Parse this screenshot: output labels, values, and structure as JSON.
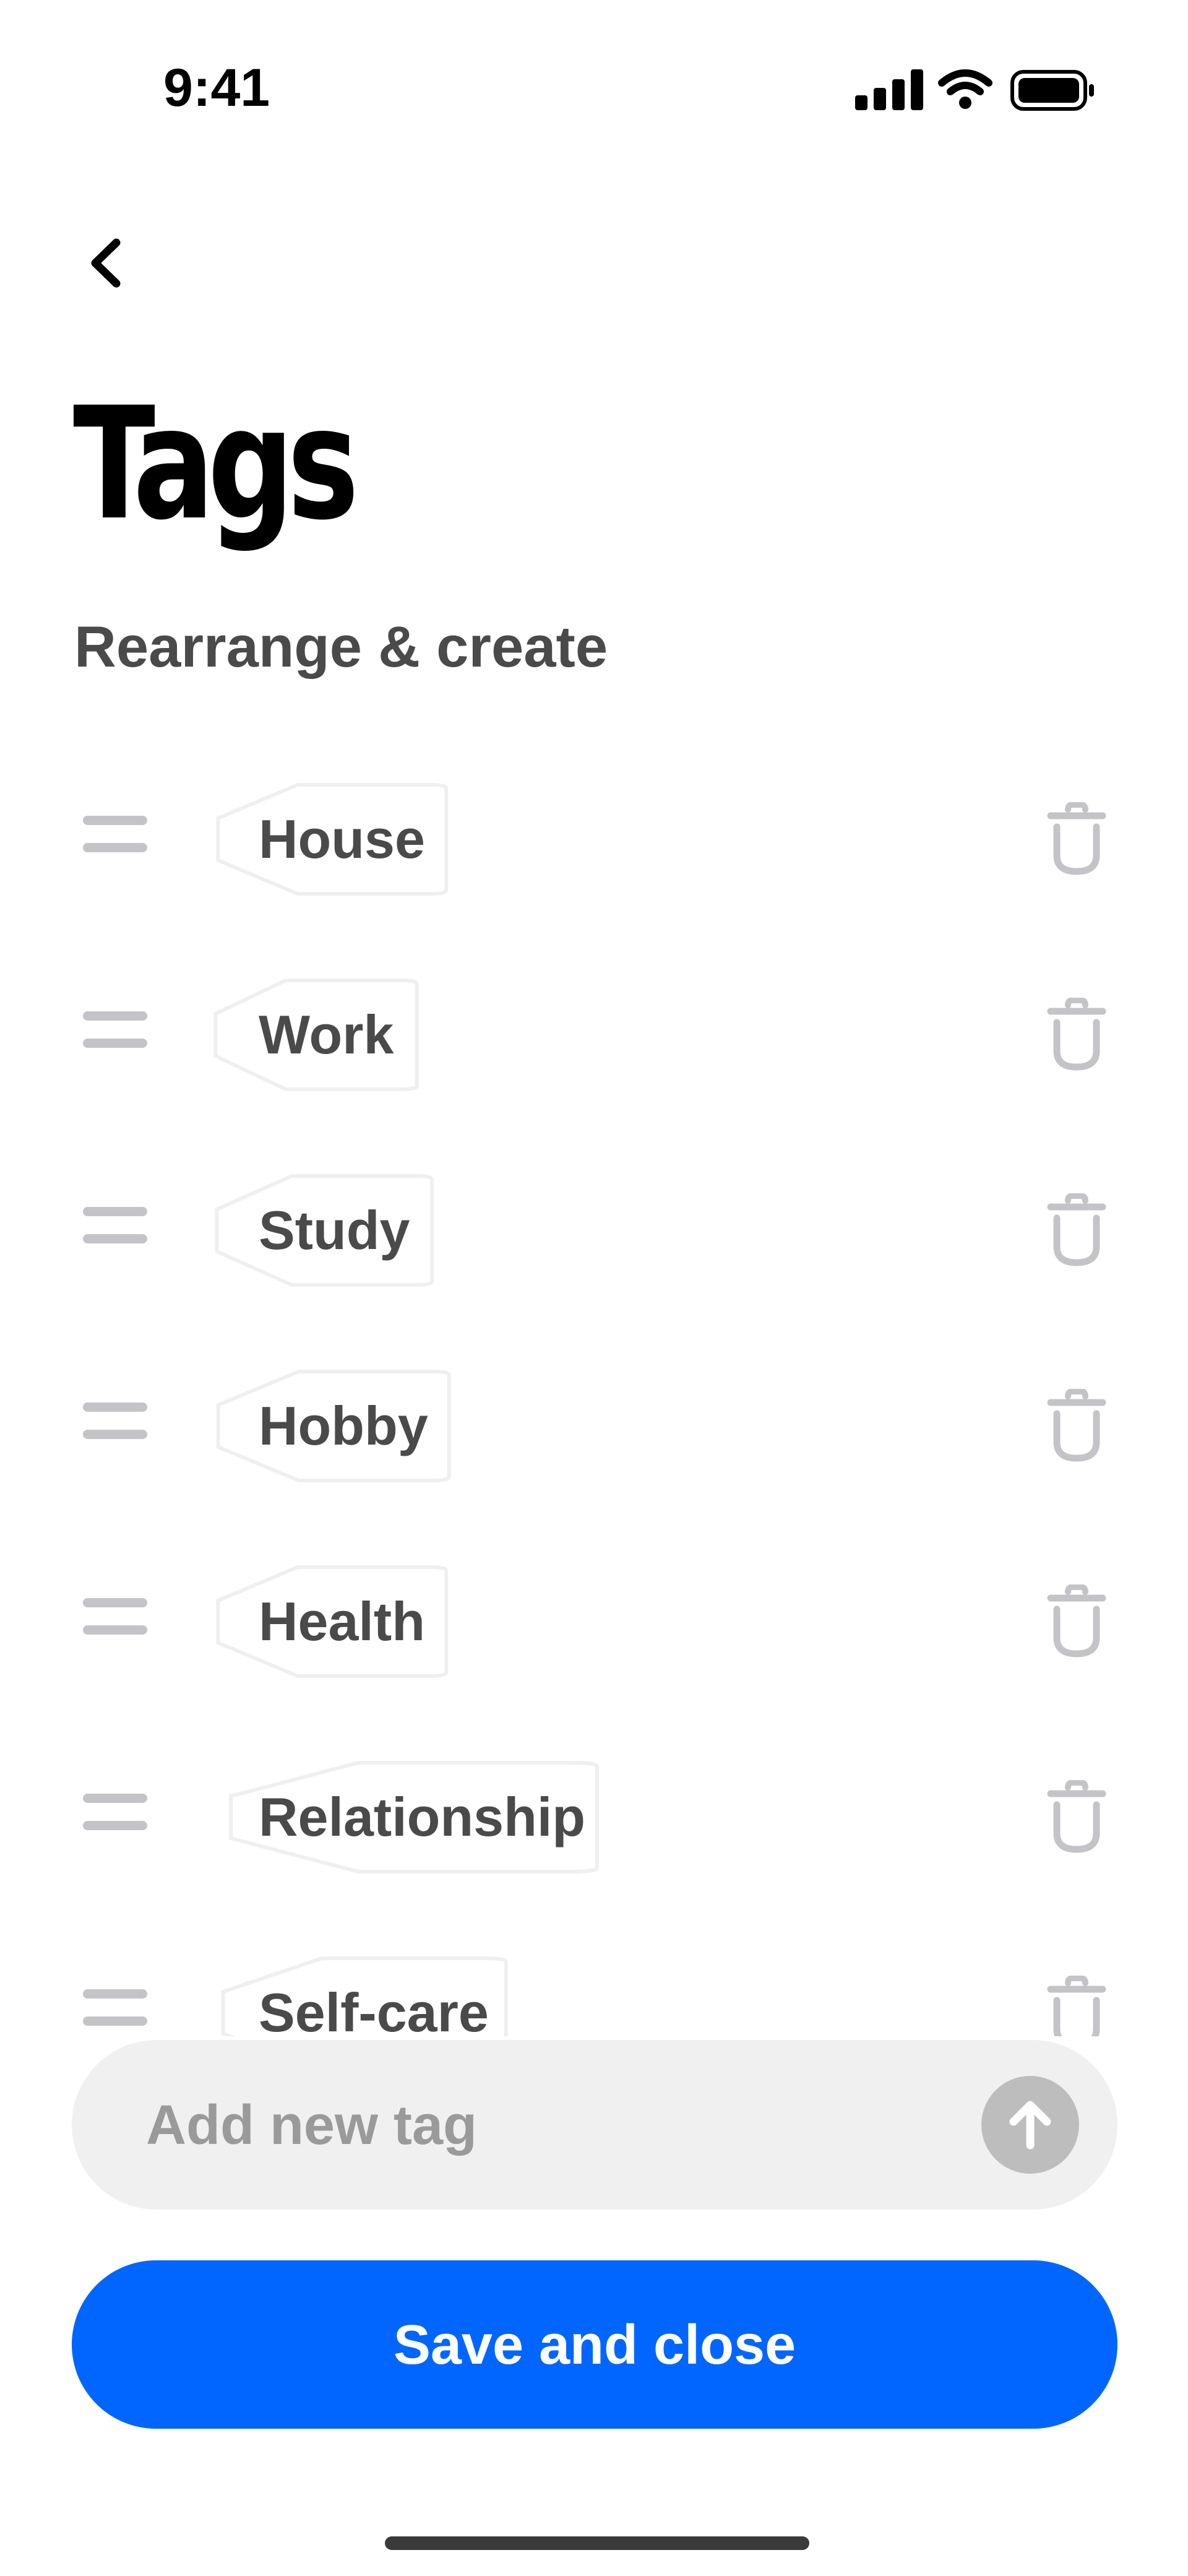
{
  "status_bar": {
    "time": "9:41",
    "icons": [
      "signal-icon",
      "wifi-icon",
      "battery-icon"
    ]
  },
  "header": {
    "back_icon": "chevron-left-icon",
    "title": "Tags",
    "subtitle": "Rearrange & create"
  },
  "tags": [
    {
      "label": "House"
    },
    {
      "label": "Work"
    },
    {
      "label": "Study"
    },
    {
      "label": "Hobby"
    },
    {
      "label": "Health"
    },
    {
      "label": "Relationship"
    },
    {
      "label": "Self-care"
    }
  ],
  "add_tag": {
    "placeholder": "Add new tag",
    "submit_icon": "arrow-up-icon"
  },
  "save_button": {
    "label": "Save and close"
  },
  "colors": {
    "accent": "#0066ff",
    "text_primary": "#000000",
    "text_secondary": "#4a4a4a",
    "muted_icon": "#c4c4c8",
    "input_bg": "#f0f0f0",
    "chip_border": "#efefef"
  }
}
